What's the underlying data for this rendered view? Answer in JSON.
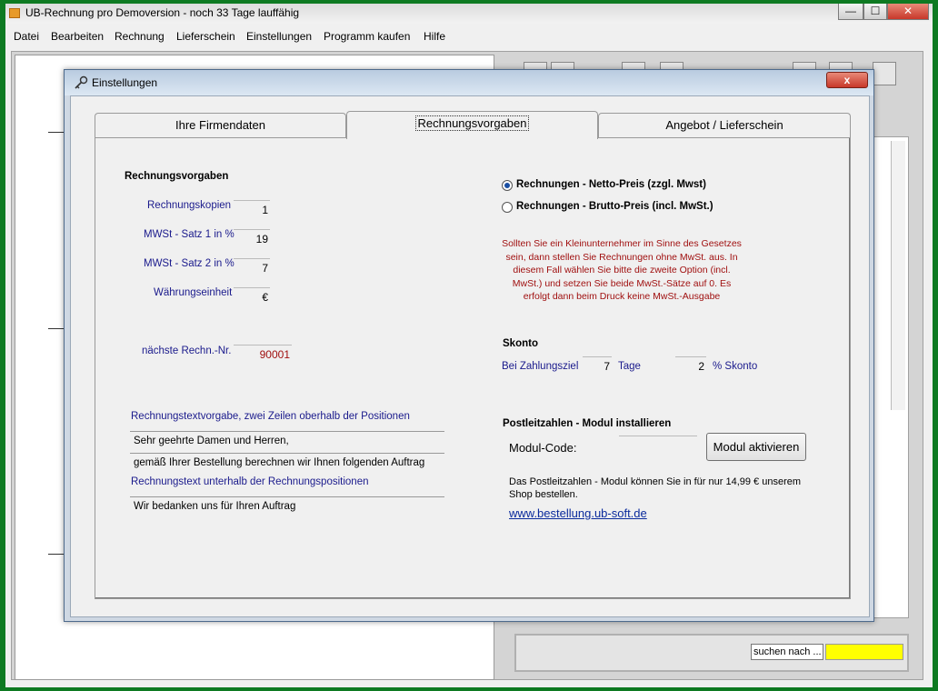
{
  "app": {
    "title": "UB-Rechnung pro  Demoversion - noch 33 Tage lauffähig",
    "window_controls": [
      "—",
      "☐",
      "✕"
    ]
  },
  "menu": [
    "Datei",
    "Bearbeiten",
    "Rechnung",
    "Lieferschein",
    "Einstellungen",
    "Programm kaufen",
    "Hilfe"
  ],
  "background": {
    "search_label": "suchen nach ...",
    "search_value": ""
  },
  "dialog": {
    "title": "Einstellungen",
    "close_label": "x",
    "tabs": [
      {
        "label": "Ihre Firmendaten",
        "active": false
      },
      {
        "label": "Rechnungsvorgaben",
        "active": true
      },
      {
        "label": "Angebot / Lieferschein",
        "active": false
      }
    ],
    "left": {
      "section_title": "Rechnungsvorgaben",
      "fields": [
        {
          "label": "Rechnungskopien",
          "value": "1"
        },
        {
          "label": "MWSt - Satz 1 in %",
          "value": "19"
        },
        {
          "label": "MWSt - Satz 2 in %",
          "value": "7"
        },
        {
          "label": "Währungseinheit",
          "value": "€"
        }
      ],
      "next_nr_label": "nächste Rechn.-Nr.",
      "next_nr_value": "90001",
      "text_above_label": "Rechnungstextvorgabe,  zwei Zeilen oberhalb der Positionen",
      "text_above_line1": "Sehr geehrte Damen und Herren,",
      "text_above_line2": "gemäß Ihrer Bestellung berechnen wir Ihnen folgenden Auftrag",
      "text_below_label": "Rechnungstext unterhalb der Rechnungspositionen",
      "text_below_line1": "Wir bedanken uns für Ihren Auftrag"
    },
    "right": {
      "radio_netto": "Rechnungen - Netto-Preis  (zzgl. Mwst)",
      "radio_brutto": "Rechnungen - Brutto-Preis  (incl. MwSt.)",
      "selected": "netto",
      "note_lines": [
        "Sollten Sie ein Kleinunternehmer im Sinne des Gesetzes",
        "sein, dann stellen Sie Rechnungen ohne MwSt. aus. In",
        "diesem Fall wählen Sie bitte die zweite Option (incl.",
        "MwSt.) und setzen Sie beide MwSt.-Sätze auf 0. Es",
        "erfolgt dann beim Druck keine MwSt.-Ausgabe"
      ],
      "skonto_title": "Skonto",
      "skonto_label": "Bei Zahlungsziel",
      "skonto_days": "7",
      "skonto_days_unit": "Tage",
      "skonto_percent": "2",
      "skonto_percent_unit": "% Skonto",
      "plz_title": "Postleitzahlen - Modul installieren",
      "modul_code_label": "Modul-Code:",
      "modul_code_value": "",
      "modul_button": "Modul aktivieren",
      "plz_note_line1": "Das Postleitzahlen - Modul können Sie in für nur 14,99 € unserem",
      "plz_note_line2": "Shop bestellen.",
      "shop_link": "www.bestellung.ub-soft.de"
    }
  },
  "colors": {
    "accent_blue": "#1a1a8c",
    "red_text": "#a01010",
    "search_yellow": "#ffff00"
  }
}
